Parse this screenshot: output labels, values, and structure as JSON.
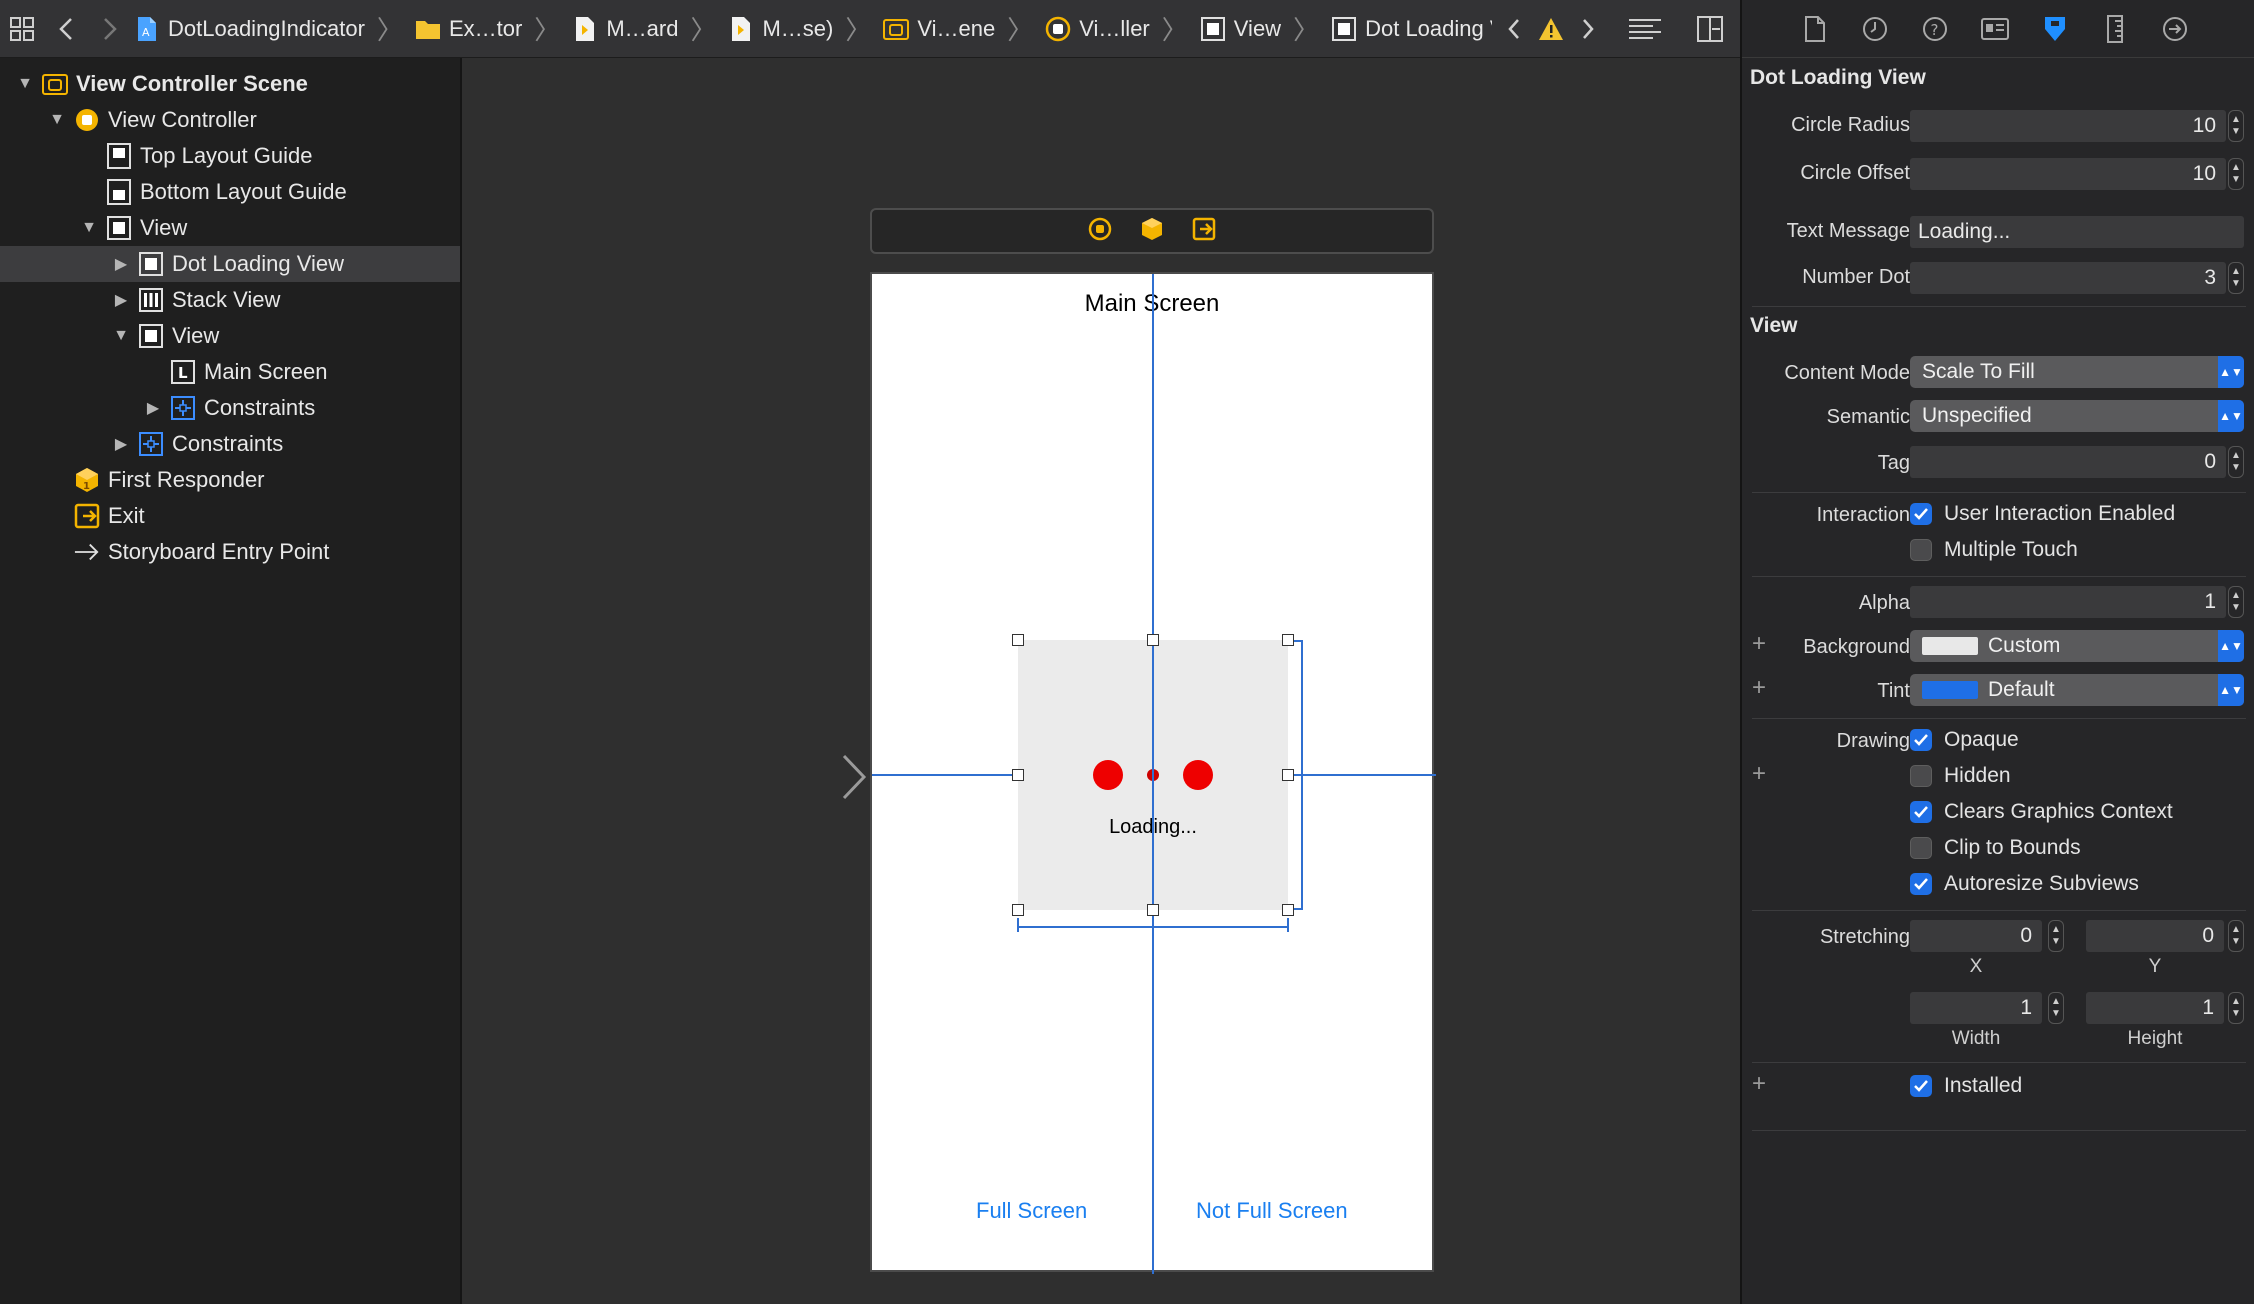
{
  "jumpbar": {
    "crumbs": [
      {
        "label": "DotLoadingIndicator",
        "icon": "project-icon"
      },
      {
        "label": "Ex…tor",
        "icon": "folder-icon"
      },
      {
        "label": "M…ard",
        "icon": "storyboard-file-icon"
      },
      {
        "label": "M…se)",
        "icon": "storyboard-file-icon"
      },
      {
        "label": "Vi…ene",
        "icon": "scene-icon"
      },
      {
        "label": "Vi…ller",
        "icon": "view-controller-icon"
      },
      {
        "label": "View",
        "icon": "view-icon"
      },
      {
        "label": "Dot Loading View",
        "icon": "view-icon"
      }
    ]
  },
  "outline": {
    "scene": "View Controller Scene",
    "view_controller": "View Controller",
    "top_layout_guide": "Top Layout Guide",
    "bottom_layout_guide": "Bottom Layout Guide",
    "view": "View",
    "dot_loading_view": "Dot Loading View",
    "stack_view": "Stack View",
    "inner_view": "View",
    "main_screen_label": "Main Screen",
    "inner_constraints": "Constraints",
    "constraints": "Constraints",
    "first_responder": "First Responder",
    "exit": "Exit",
    "entry_point": "Storyboard Entry Point"
  },
  "canvas": {
    "screen_title": "Main Screen",
    "loading_text": "Loading...",
    "full_screen": "Full Screen",
    "not_full_screen": "Not Full Screen",
    "dot_color": "#ee0000"
  },
  "inspector": {
    "custom_title": "Dot Loading View",
    "circle_radius_label": "Circle Radius",
    "circle_radius": "10",
    "circle_offset_label": "Circle Offset",
    "circle_offset": "10",
    "text_message_label": "Text Message",
    "text_message": "Loading...",
    "number_dot_label": "Number Dot",
    "number_dot": "3",
    "view_title": "View",
    "content_mode_label": "Content Mode",
    "content_mode": "Scale To Fill",
    "semantic_label": "Semantic",
    "semantic": "Unspecified",
    "tag_label": "Tag",
    "tag": "0",
    "interaction_label": "Interaction",
    "user_interaction": "User Interaction Enabled",
    "multiple_touch": "Multiple Touch",
    "alpha_label": "Alpha",
    "alpha": "1",
    "background_label": "Background",
    "background": "Custom",
    "background_color": "#e8e8e8",
    "tint_label": "Tint",
    "tint": "Default",
    "tint_color": "#1f6fe6",
    "drawing_label": "Drawing",
    "opaque": "Opaque",
    "hidden": "Hidden",
    "clears_graphics": "Clears Graphics Context",
    "clip_bounds": "Clip to Bounds",
    "autoresize": "Autoresize Subviews",
    "stretching_label": "Stretching",
    "stretch_x": "0",
    "stretch_y": "0",
    "x_label": "X",
    "y_label": "Y",
    "stretch_w": "1",
    "stretch_h": "1",
    "width_label": "Width",
    "height_label": "Height",
    "installed": "Installed"
  }
}
